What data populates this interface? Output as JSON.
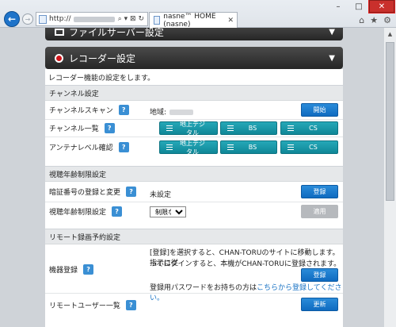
{
  "browser": {
    "url_prefix": "http://",
    "address_controls": "⌕ ▾ ⊠ ↻",
    "tab_title": "nasne™ HOME (nasne)",
    "window_controls": {
      "minimize": "–",
      "maximize": "□",
      "close": "✕"
    },
    "tool_icons": {
      "home": "⌂",
      "favorites": "★",
      "settings": "⚙"
    }
  },
  "panels": {
    "file_server": "ファイルサーバー設定",
    "recorder": "レコーダー設定"
  },
  "recorder": {
    "description": "レコーダー機能の設定をします。",
    "channel": {
      "heading": "チャンネル設定",
      "scan_label": "チャンネルスキャン",
      "region_label": "地域:",
      "start_button": "開始",
      "list_label": "チャンネル一覧",
      "antenna_label": "アンテナレベル確認",
      "tuners": [
        "地上デジタル",
        "BS",
        "CS"
      ]
    },
    "age": {
      "heading": "視聴年齢制限設定",
      "pin_label": "暗証番号の登録と変更",
      "pin_status": "未設定",
      "register_button": "登録",
      "restrict_label": "視聴年齢制限設定",
      "restrict_value": "制限なし",
      "apply_button": "適用"
    },
    "remote": {
      "heading": "リモート録画予約設定",
      "device_label": "機器登録",
      "device_text_1": "[登録]を選択すると、CHAN-TORUのサイトに移動します。指示に従",
      "device_text_2": "ってログインすると、本機がCHAN-TORUに登録されます。",
      "register_button": "登録",
      "password_text": "登録用パスワードをお持ちの方は",
      "password_link": "こちらから登録してください。",
      "users_label": "リモートユーザー一覧",
      "update_button": "更新"
    }
  },
  "help_glyph": "?"
}
